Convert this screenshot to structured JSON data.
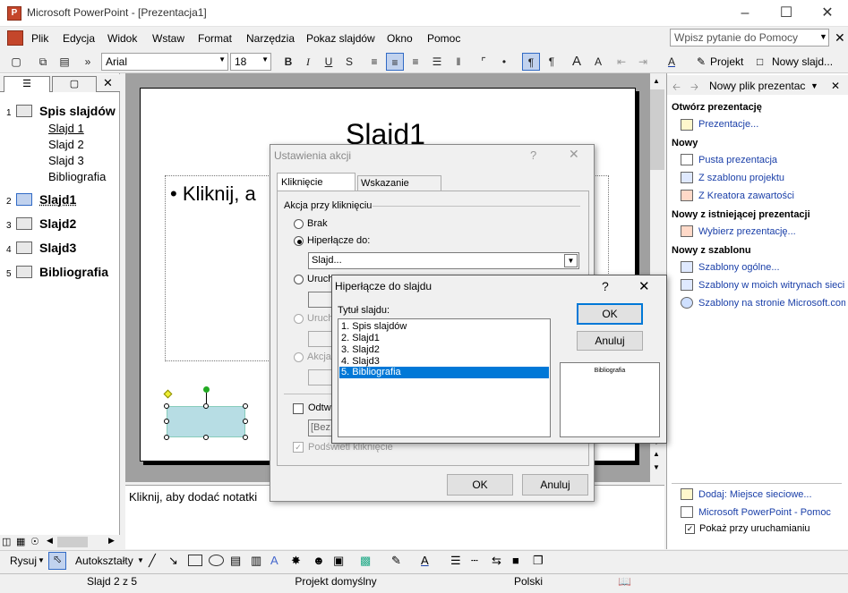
{
  "window": {
    "title": "Microsoft PowerPoint - [Prezentacja1]",
    "app_icon": "powerpoint-icon"
  },
  "menu": {
    "items": [
      "Plik",
      "Edycja",
      "Widok",
      "Wstaw",
      "Format",
      "Narzędzia",
      "Pokaz slajdów",
      "Okno",
      "Pomoc"
    ],
    "help_placeholder": "Wpisz pytanie do Pomocy"
  },
  "toolbar": {
    "font": "Arial",
    "size": "18",
    "project_label": "Projekt",
    "new_slide_label": "Nowy slajd..."
  },
  "outline": {
    "items": [
      {
        "num": "1",
        "title": "Spis slajdów",
        "subs": [
          "Slajd 1",
          "Slajd 2",
          "Slajd 3",
          "Bibliografia"
        ]
      },
      {
        "num": "2",
        "title": "Slajd1"
      },
      {
        "num": "3",
        "title": "Slajd2"
      },
      {
        "num": "4",
        "title": "Slajd3"
      },
      {
        "num": "5",
        "title": "Bibliografia"
      }
    ]
  },
  "slide": {
    "title": "Slajd1",
    "bullet": "Kliknij, a"
  },
  "notes": {
    "placeholder": "Kliknij, aby dodać notatki"
  },
  "taskpane": {
    "title": "Nowy plik prezentac",
    "sections": [
      {
        "heading": "Otwórz prezentację",
        "links": [
          "Prezentacje..."
        ]
      },
      {
        "heading": "Nowy",
        "links": [
          "Pusta prezentacja",
          "Z szablonu projektu",
          "Z Kreatora zawartości"
        ]
      },
      {
        "heading": "Nowy z istniejącej prezentacji",
        "links": [
          "Wybierz prezentację..."
        ]
      },
      {
        "heading": "Nowy z szablonu",
        "links": [
          "Szablony ogólne...",
          "Szablony w moich witrynach sieci W",
          "Szablony na stronie Microsoft.com"
        ]
      }
    ],
    "footer_links": [
      "Dodaj: Miejsce sieciowe...",
      "Microsoft PowerPoint - Pomoc"
    ],
    "startup_checkbox": "Pokaż przy uruchamianiu"
  },
  "action_dialog": {
    "title": "Ustawienia akcji",
    "tabs": [
      "Kliknięcie myszą",
      "Wskazanie myszą"
    ],
    "group": "Akcja przy kliknięciu",
    "options": [
      "Brak",
      "Hiperłącze do:",
      "Uruch",
      "Uruch",
      "Akcja"
    ],
    "hyperlink_value": "Slajd...",
    "sound_label": "Odtw",
    "sound_value": "[Bez",
    "highlight_label": "Podświetl kliknięcie",
    "ok": "OK",
    "cancel": "Anuluj"
  },
  "link_dialog": {
    "title": "Hiperłącze do slajdu",
    "list_label": "Tytuł slajdu:",
    "slides": [
      "1. Spis slajdów",
      "2. Slajd1",
      "3. Slajd2",
      "4. Slajd3",
      "5. Bibliografia"
    ],
    "selected_index": 4,
    "preview_text": "Bibliografia",
    "ok": "OK",
    "cancel": "Anuluj"
  },
  "drawing": {
    "draw_label": "Rysuj",
    "autoshapes_label": "Autokształty"
  },
  "status": {
    "slide": "Slajd 2 z 5",
    "design": "Projekt domyślny",
    "language": "Polski"
  },
  "colors": {
    "selection": "#0078d7",
    "link": "#1a3fa8",
    "shape_fill": "#b7dde4"
  }
}
